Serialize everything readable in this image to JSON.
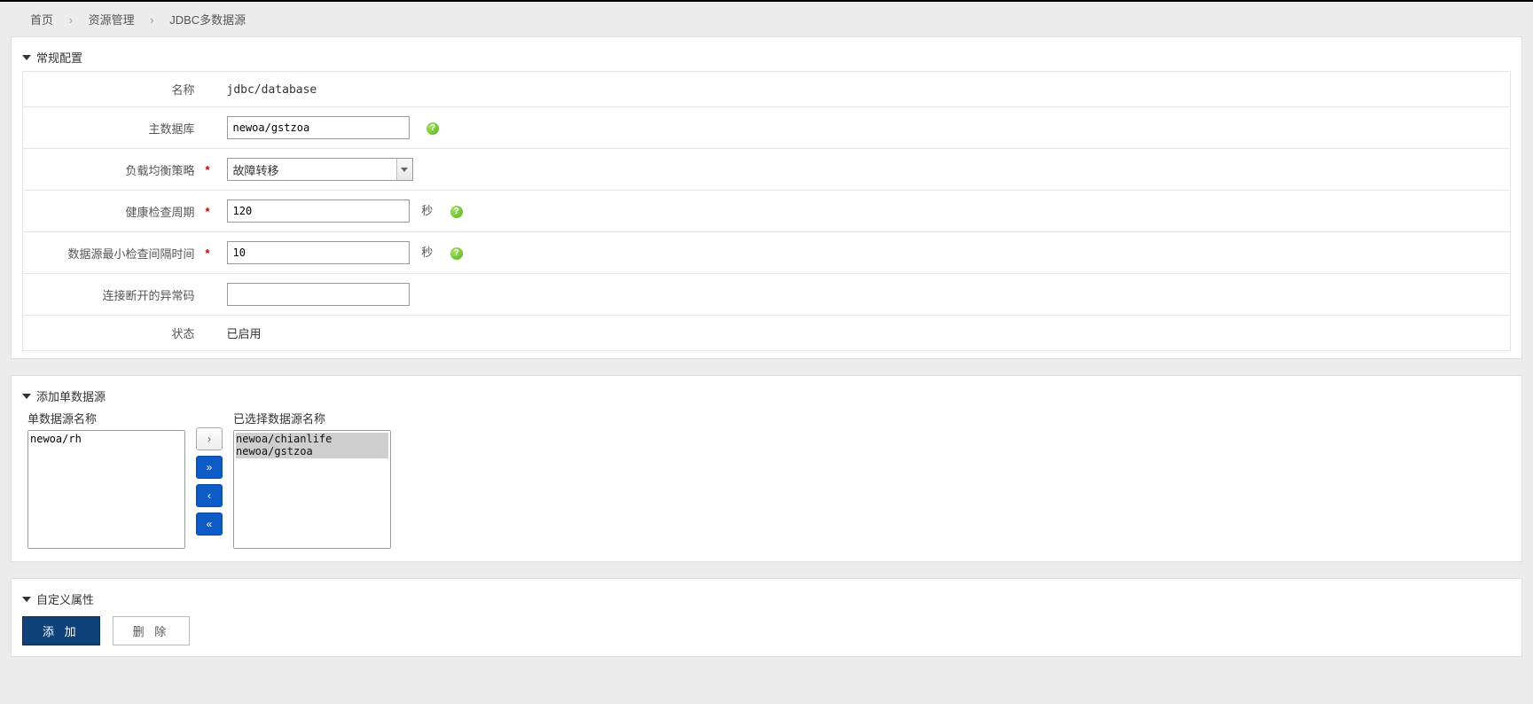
{
  "breadcrumb": {
    "home": "首页",
    "resource": "资源管理",
    "current": "JDBC多数据源"
  },
  "section1": {
    "title": "常规配置",
    "fields": {
      "name_label": "名称",
      "name_value": "jdbc/database",
      "master_label": "主数据库",
      "master_value": "newoa/gstzoa",
      "lb_label": "负载均衡策略",
      "lb_value": "故障转移",
      "health_label": "健康检查周期",
      "health_value": "120",
      "health_unit": "秒",
      "min_label": "数据源最小检查间隔时间",
      "min_value": "10",
      "min_unit": "秒",
      "excode_label": "连接断开的异常码",
      "excode_value": "",
      "status_label": "状态",
      "status_value": "已启用"
    },
    "required_mark": "*"
  },
  "section2": {
    "title": "添加单数据源",
    "left_label": "单数据源名称",
    "right_label": "已选择数据源名称",
    "left_items": [
      "newoa/rh"
    ],
    "right_items": [
      "newoa/chianlife",
      "newoa/gstzoa"
    ],
    "btn_right": "›",
    "btn_right_all": "»",
    "btn_left": "‹",
    "btn_left_all": "«"
  },
  "section3": {
    "title": "自定义属性",
    "add_btn": "添 加",
    "del_btn": "删 除"
  }
}
